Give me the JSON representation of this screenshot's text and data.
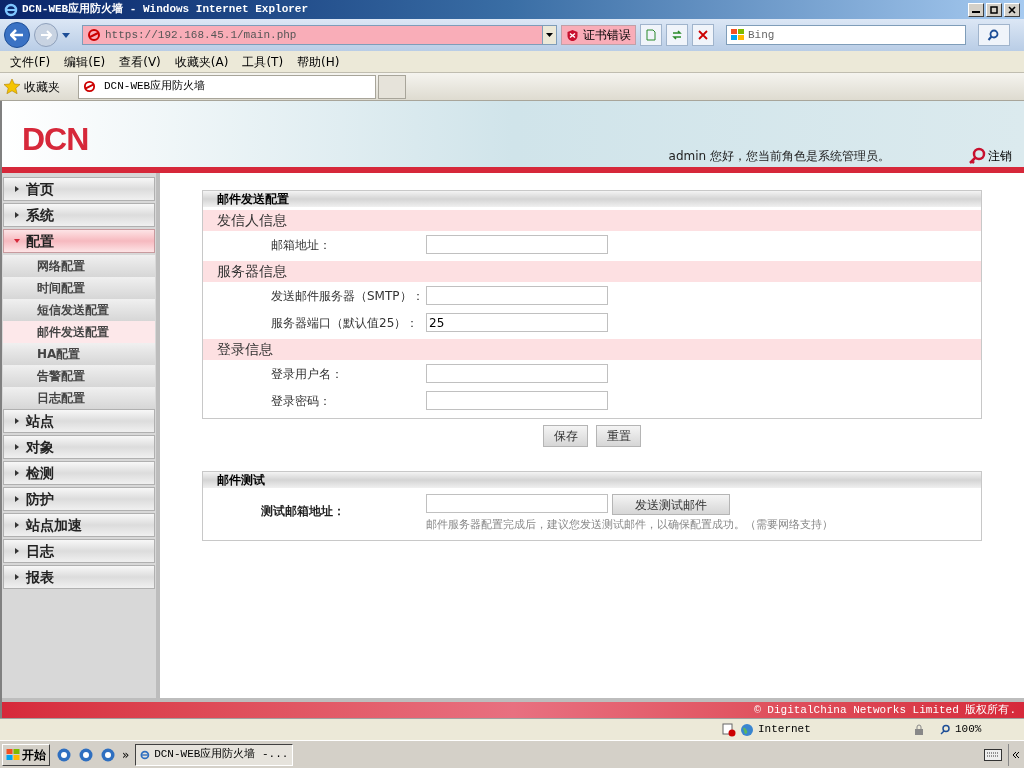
{
  "window": {
    "title": "DCN-WEB应用防火墙 - Windows Internet Explorer"
  },
  "address_bar": {
    "url": "https://192.168.45.1/main.php",
    "cert_error": "证书错误",
    "search_placeholder": "Bing"
  },
  "menu": [
    "文件(F)",
    "编辑(E)",
    "查看(V)",
    "收藏夹(A)",
    "工具(T)",
    "帮助(H)"
  ],
  "favorites_bar": {
    "label": "收藏夹",
    "tabs": [
      {
        "label": "DCN-WEB应用防火墙",
        "selected": true
      }
    ]
  },
  "header": {
    "logo": "DCN",
    "greeting": "admin 您好，您当前角色是系统管理员。",
    "logout": "注销"
  },
  "sidebar": [
    {
      "label": "首页",
      "expanded": false
    },
    {
      "label": "系统",
      "expanded": false
    },
    {
      "label": "配置",
      "expanded": true,
      "children": [
        {
          "label": "网络配置",
          "selected": false
        },
        {
          "label": "时间配置",
          "selected": false
        },
        {
          "label": "短信发送配置",
          "selected": false
        },
        {
          "label": "邮件发送配置",
          "selected": true
        },
        {
          "label": "HA配置",
          "selected": false
        },
        {
          "label": "告警配置",
          "selected": false
        },
        {
          "label": "日志配置",
          "selected": false
        }
      ]
    },
    {
      "label": "站点",
      "expanded": false
    },
    {
      "label": "对象",
      "expanded": false
    },
    {
      "label": "检测",
      "expanded": false
    },
    {
      "label": "防护",
      "expanded": false
    },
    {
      "label": "站点加速",
      "expanded": false
    },
    {
      "label": "日志",
      "expanded": false
    },
    {
      "label": "报表",
      "expanded": false
    }
  ],
  "mail_config": {
    "title": "邮件发送配置",
    "sections": [
      {
        "title": "发信人信息",
        "fields": [
          {
            "label": "邮箱地址："
          }
        ]
      },
      {
        "title": "服务器信息",
        "fields": [
          {
            "label": "发送邮件服务器（SMTP）："
          },
          {
            "label": "服务器端口（默认值25）：",
            "value": "25"
          }
        ]
      },
      {
        "title": "登录信息",
        "fields": [
          {
            "label": "登录用户名："
          },
          {
            "label": "登录密码："
          }
        ]
      }
    ],
    "buttons": [
      "保存",
      "重置"
    ]
  },
  "mail_test": {
    "title": "邮件测试",
    "label": "测试邮箱地址：",
    "button": "发送测试邮件",
    "hint": "邮件服务器配置完成后，建议您发送测试邮件，以确保配置成功。（需要网络支持）"
  },
  "footer": "© DigitalChina Networks Limited 版权所有.",
  "status_bar": {
    "zone": "Internet",
    "zoom": "100%"
  },
  "taskbar": {
    "start": "开始",
    "more": "»",
    "tasks": [
      "DCN-WEB应用防火墙 -..."
    ]
  }
}
